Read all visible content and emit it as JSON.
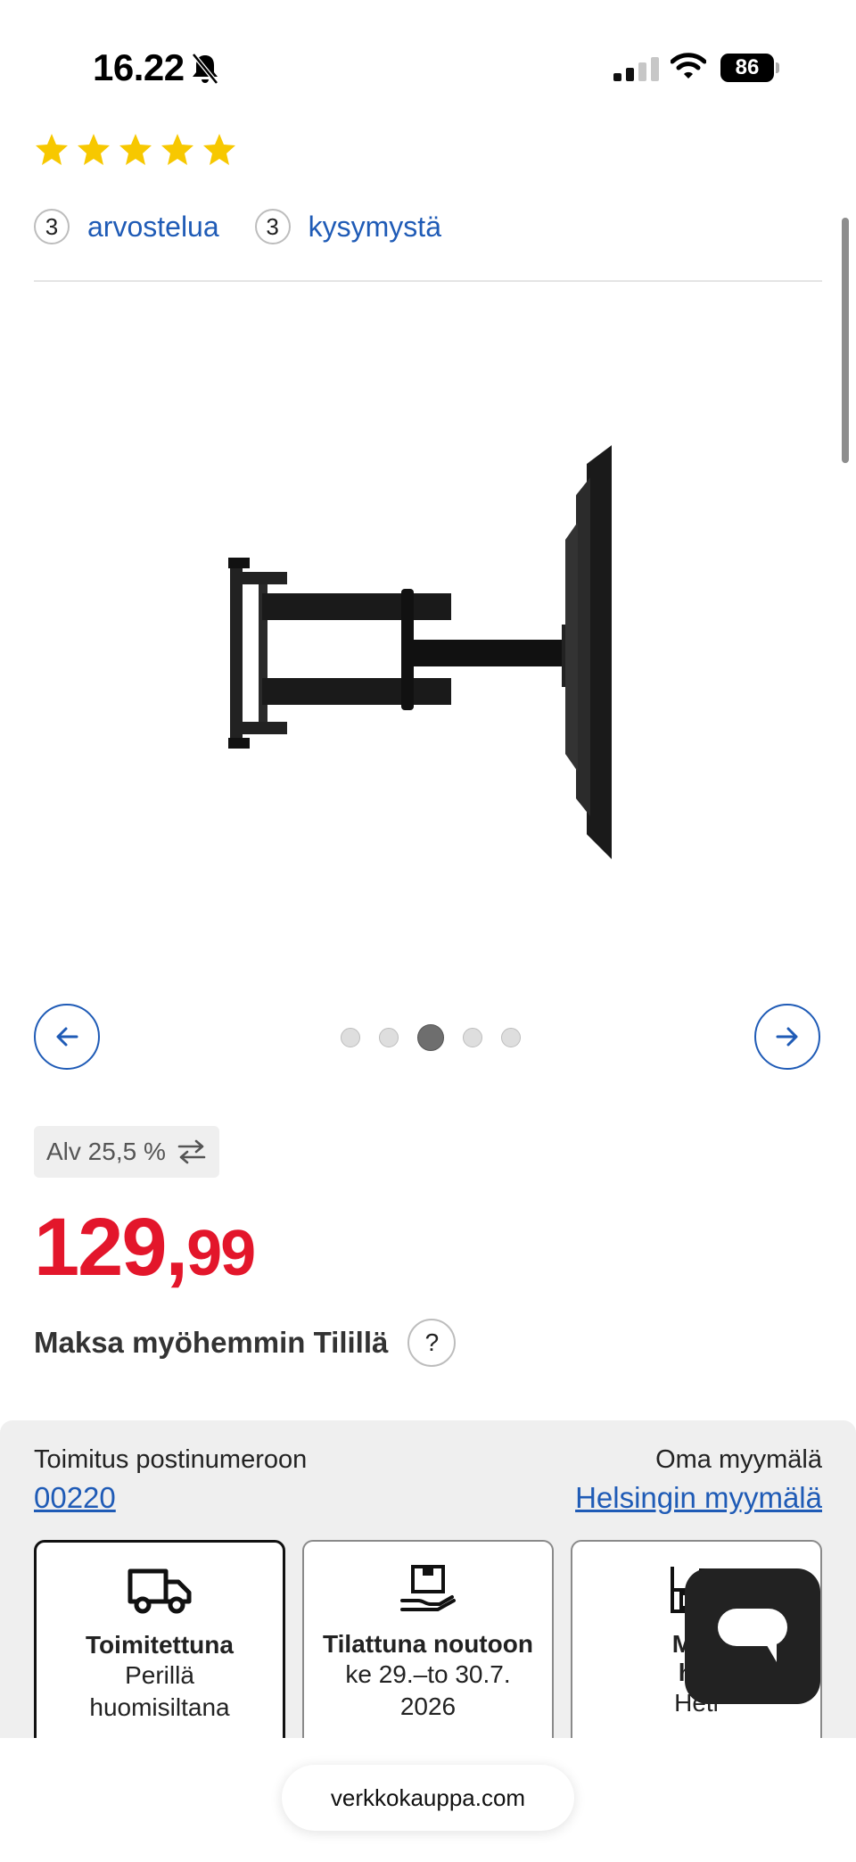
{
  "status": {
    "time": "16.22",
    "battery": "86",
    "icons": [
      "bell-slash-icon",
      "signal-icon",
      "wifi-icon",
      "battery-icon"
    ]
  },
  "rating": {
    "stars": 5,
    "max_stars": 5,
    "star_color": "#f7c800",
    "reviews_count": "3",
    "reviews_label": "arvostelua",
    "questions_count": "3",
    "questions_label": "kysymystä"
  },
  "gallery": {
    "total_images": 5,
    "active_index": 3,
    "prev_icon": "arrow-left-icon",
    "next_icon": "arrow-right-icon"
  },
  "vat": {
    "label": "Alv 25,5 %",
    "icon": "swap-arrows-icon"
  },
  "price": {
    "integer": "129,",
    "decimals": "99",
    "color": "#e3162b"
  },
  "paylater": {
    "label": "Maksa myöhemmin Tilillä",
    "help": "?"
  },
  "delivery": {
    "postal_label": "Toimitus postinumeroon",
    "postal_code": "00220",
    "store_label": "Oma myymälä",
    "store_link": "Helsingin myymälä",
    "options": [
      {
        "icon": "truck-icon",
        "title": "Toimitettuna",
        "line1": "Perillä",
        "line2": "huomisiltana"
      },
      {
        "icon": "package-hand-icon",
        "title": "Tilattuna noutoon",
        "line1": "ke 29.–to 30.7.",
        "line2": "2026"
      },
      {
        "icon": "shelf-icon",
        "title": "Myy",
        "title2": "hyl",
        "line1": "Heti"
      }
    ]
  },
  "chat": {
    "icon": "chat-bubble-icon"
  },
  "browser": {
    "url": "verkkokauppa.com"
  },
  "colors": {
    "link": "#1f5bb6",
    "price": "#e3162b"
  }
}
